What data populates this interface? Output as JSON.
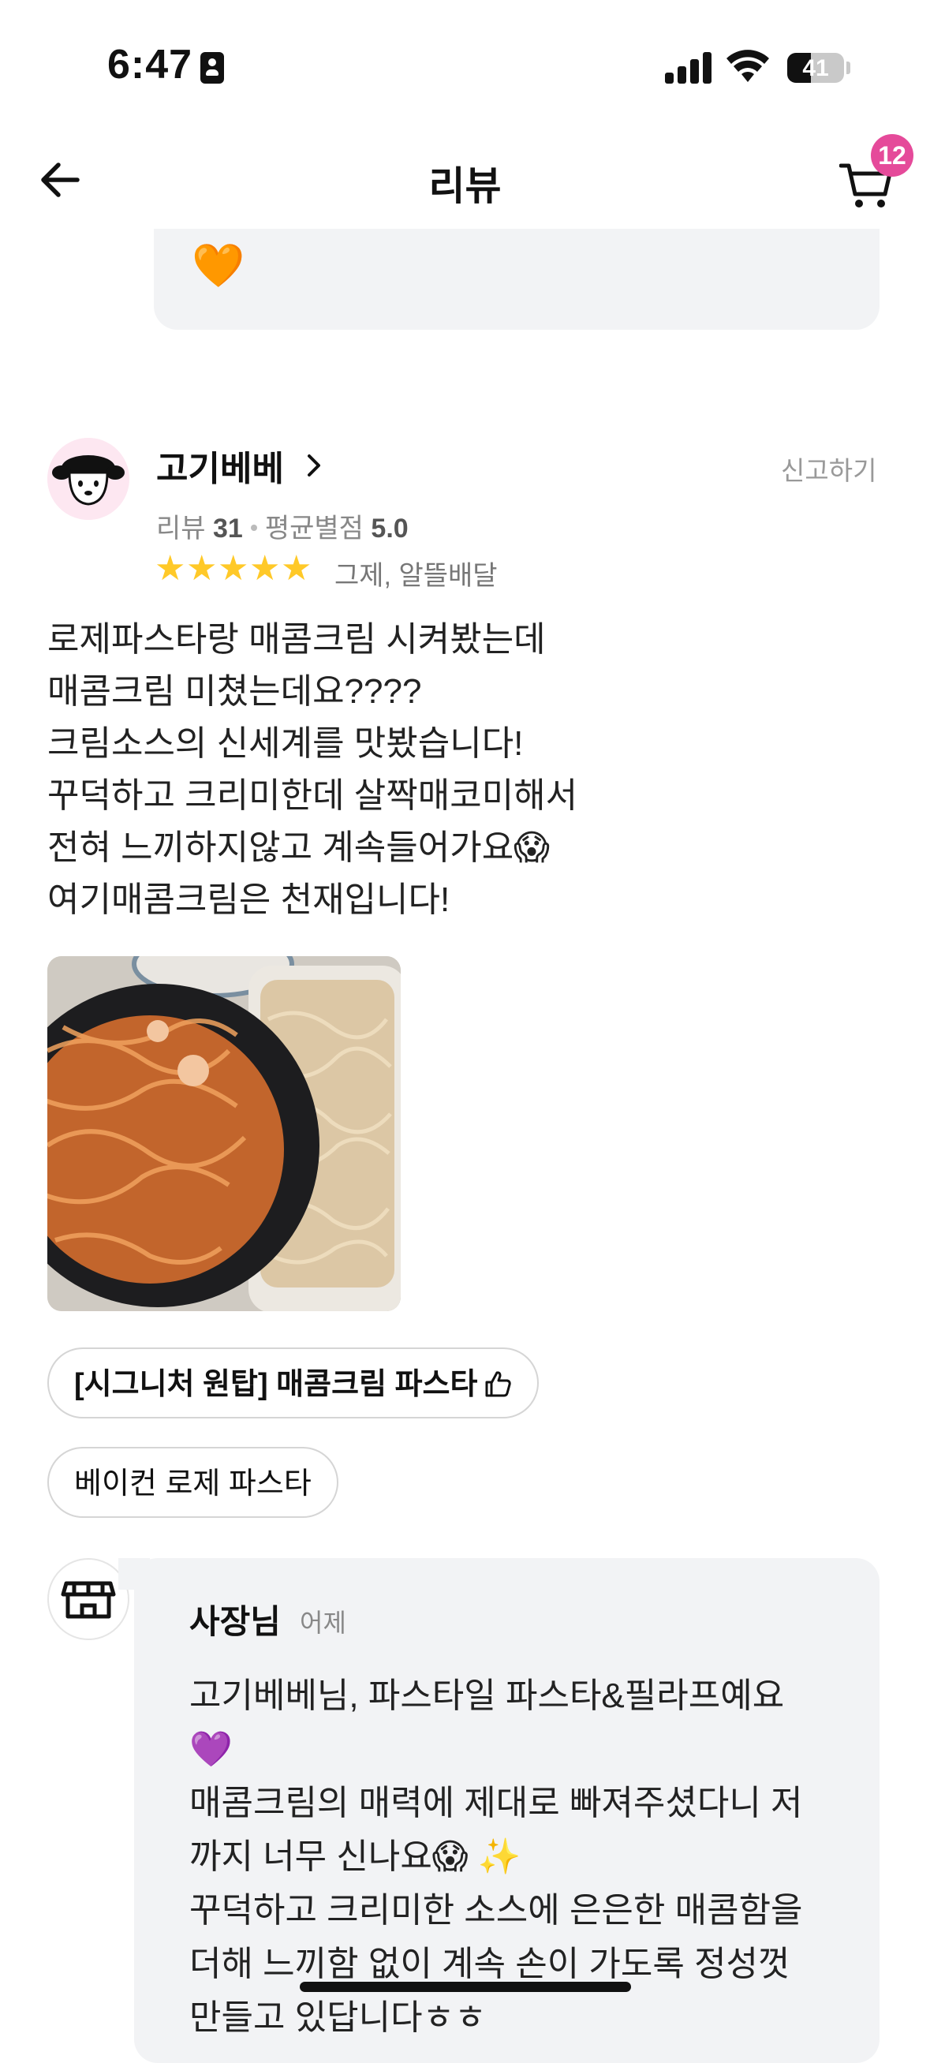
{
  "status_bar": {
    "time": "6:47",
    "battery": "41",
    "battery_level": 0.41
  },
  "nav": {
    "title": "리뷰",
    "cart_count": "12"
  },
  "prev_reply": {
    "emoji": "🧡"
  },
  "review": {
    "reviewer": "고기베베",
    "report": "신고하기",
    "meta_review_label": "리뷰",
    "meta_review_count": "31",
    "meta_avg_label": "평균별점",
    "meta_avg_value": "5.0",
    "rating": 5,
    "star_note": "그제, 알뜰배달",
    "text": "로제파스타랑 매콤크림 시켜봤는데\n매콤크림 미쳤는데요????\n크림소스의 신세계를 맛봤습니다!\n꾸덕하고 크리미한데 살짝매코미해서\n전혀 느끼하지않고 계속들어가요😱\n여기매콤크림은 천재입니다!",
    "tags": [
      "[시그니처 원탑] 매콤크림 파스타",
      "베이컨 로제 파스타"
    ]
  },
  "owner_reply": {
    "name": "사장님",
    "date": "어제",
    "text": "고기베베님, 파스타일 파스타&필라프예요\n💜\n매콤크림의 매력에 제대로 빠져주셨다니 저\n까지 너무 신나요😱 ✨\n꾸덕하고 크리미한 소스에 은은한 매콤함을\n더해 느끼함 없이 계속 손이 가도록 정성껏\n만들고 있답니다ㅎㅎ"
  },
  "colors": {
    "accent_pink": "#e54a9a",
    "star": "#ffc928",
    "card_bg": "#f2f3f5"
  }
}
